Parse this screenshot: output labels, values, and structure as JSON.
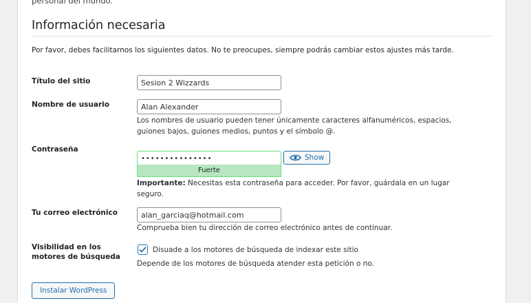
{
  "intro": {
    "trailing_text": "personal del mundo."
  },
  "section": {
    "heading": "Información necesaria",
    "instructions": "Por favor, debes facilitarnos los siguientes datos. No te preocupes, siempre podrás cambiar estos ajustes más tarde."
  },
  "fields": {
    "site_title": {
      "label": "Título del sitio",
      "value": "Sesion 2 Wizzards"
    },
    "username": {
      "label": "Nombre de usuario",
      "value": "Alan Alexander",
      "description": "Los nombres de usuario pueden tener únicamente caracteres alfanuméricos, espacios, guiones bajos, guiones medios, puntos y el símbolo @."
    },
    "password": {
      "label": "Contraseña",
      "masked_value": "•••••••••••••••",
      "strength": "Fuerte",
      "strength_color": "#b8e6bf",
      "show_label": "Show",
      "show_icon": "eye-icon",
      "important_label": "Importante:",
      "important_text": " Necesitas esta contraseña para acceder. Por favor, guárdala en un lugar seguro."
    },
    "email": {
      "label": "Tu correo electrónico",
      "value": "alan_garciaq@hotmail.com",
      "description": "Comprueba bien tu dirección de correo electrónico antes de continuar."
    },
    "search_visibility": {
      "label": "Visibilidad en los motores de búsqueda",
      "checked": true,
      "checkbox_label": "Disuade a los motores de búsqueda de indexar este sitio",
      "description": "Depende de los motores de búsqueda atender esta petición o no."
    }
  },
  "actions": {
    "install_label": "Instalar WordPress"
  },
  "colors": {
    "accent": "#2271b1",
    "strength_border": "#68de7c",
    "page_bg": "#f0f0f1"
  }
}
